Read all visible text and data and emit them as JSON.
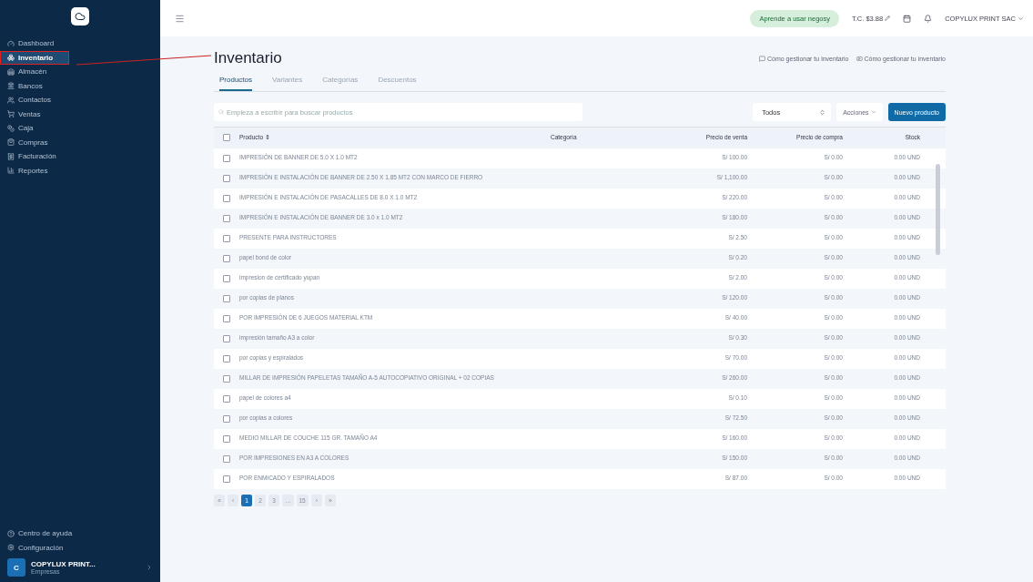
{
  "sidebar": {
    "items": [
      {
        "label": "Dashboard",
        "selected": false,
        "annotated": false
      },
      {
        "label": "Inventario",
        "selected": true,
        "annotated": true
      },
      {
        "label": "Almacén",
        "selected": false,
        "annotated": false
      },
      {
        "label": "Bancos",
        "selected": false,
        "annotated": false
      },
      {
        "label": "Contactos",
        "selected": false,
        "annotated": false
      },
      {
        "label": "Ventas",
        "selected": false,
        "annotated": false
      },
      {
        "label": "Caja",
        "selected": false,
        "annotated": false
      },
      {
        "label": "Compras",
        "selected": false,
        "annotated": false
      },
      {
        "label": "Facturación",
        "selected": false,
        "annotated": false
      },
      {
        "label": "Reportes",
        "selected": false,
        "annotated": false
      }
    ],
    "footer_items": [
      "Centro de ayuda",
      "Configuración"
    ],
    "account": {
      "avatar": "C",
      "name": "COPYLUX PRINT...",
      "subtitle": "Empresas"
    }
  },
  "topbar": {
    "learn_button": "Aprende a usar negosy",
    "exchange_rate": "T.C. $3.88",
    "company": "COPYLUX PRINT SAC"
  },
  "page": {
    "title": "Inventario",
    "help_links": [
      "Cómo gestionar tu inventario",
      "Cómo gestionar tu inventario"
    ],
    "tabs": [
      {
        "label": "Productos",
        "selected": true
      },
      {
        "label": "Variantes",
        "selected": false
      },
      {
        "label": "Categorías",
        "selected": false
      },
      {
        "label": "Descuentos",
        "selected": false
      }
    ],
    "search": {
      "placeholder": "Empieza a escribir para buscar productos"
    },
    "filter": {
      "value": "Todos"
    },
    "actions_button": "Acciones",
    "new_button": "Nuevo producto"
  },
  "table": {
    "header_checked": false,
    "columns": [
      "Producto ⇕",
      "Categoría",
      "Precio de venta",
      "Precio de compra",
      "Stock"
    ],
    "rows": [
      {
        "checked": false,
        "product": "IMPRESIÓN DE BANNER DE 5.0 X 1.0 MT2",
        "price": "S/ 100.00",
        "cost": "S/ 0.00",
        "stock": "0.00 UND"
      },
      {
        "checked": false,
        "product": "IMPRESIÓN E INSTALACIÓN DE BANNER DE 2.50 X 1.85 MT2 CON MARCO DE FIERRO",
        "price": "S/ 1,100.00",
        "cost": "S/ 0.00",
        "stock": "0.00 UND"
      },
      {
        "checked": false,
        "product": "IMPRESIÓN E INSTALACIÓN DE PASACALLES DE 8.0 X 1.0 MT2",
        "price": "S/ 220.00",
        "cost": "S/ 0.00",
        "stock": "0.00 UND"
      },
      {
        "checked": false,
        "product": "IMPRESIÓN E INSTALACIÓN DE BANNER DE 3.0 x 1.0 MT2",
        "price": "S/ 180.00",
        "cost": "S/ 0.00",
        "stock": "0.00 UND"
      },
      {
        "checked": false,
        "product": "PRESENTE PARA INSTRUCTORES",
        "price": "S/ 2.50",
        "cost": "S/ 0.00",
        "stock": "0.00 UND"
      },
      {
        "checked": false,
        "product": "papel bond de color",
        "price": "S/ 0.20",
        "cost": "S/ 0.00",
        "stock": "0.00 UND"
      },
      {
        "checked": false,
        "product": "impresion de certificado yupan",
        "price": "S/ 2.00",
        "cost": "S/ 0.00",
        "stock": "0.00 UND"
      },
      {
        "checked": false,
        "product": "por copias de planos",
        "price": "S/ 120.00",
        "cost": "S/ 0.00",
        "stock": "0.00 UND"
      },
      {
        "checked": false,
        "product": "POR IMPRESIÓN DE 6 JUEGOS MATERIAL KTM",
        "price": "S/ 40.00",
        "cost": "S/ 0.00",
        "stock": "0.00 UND"
      },
      {
        "checked": false,
        "product": "impresión tamaño A3 a color",
        "price": "S/ 0.30",
        "cost": "S/ 0.00",
        "stock": "0.00 UND"
      },
      {
        "checked": false,
        "product": "por copias y espiralados",
        "price": "S/ 70.00",
        "cost": "S/ 0.00",
        "stock": "0.00 UND"
      },
      {
        "checked": false,
        "product": "MILLAR DE IMPRESIÓN PAPELETAS TAMAÑO A-5 AUTOCOPIATIVO ORIGINAL + 02 COPIAS",
        "price": "S/ 260.00",
        "cost": "S/ 0.00",
        "stock": "0.00 UND"
      },
      {
        "checked": false,
        "product": "papel de colores a4",
        "price": "S/ 0.10",
        "cost": "S/ 0.00",
        "stock": "0.00 UND"
      },
      {
        "checked": false,
        "product": "por copias a colores",
        "price": "S/ 72.50",
        "cost": "S/ 0.00",
        "stock": "0.00 UND"
      },
      {
        "checked": false,
        "product": "MEDIO MILLAR DE COUCHE 115 GR. TAMAÑO A4",
        "price": "S/ 160.00",
        "cost": "S/ 0.00",
        "stock": "0.00 UND"
      },
      {
        "checked": false,
        "product": "POR IMPRESIONES EN A3 A COLORES",
        "price": "S/ 150.00",
        "cost": "S/ 0.00",
        "stock": "0.00 UND"
      },
      {
        "checked": false,
        "product": "POR ENMICADO Y ESPIRALADOS",
        "price": "S/ 87.00",
        "cost": "S/ 0.00",
        "stock": "0.00 UND"
      }
    ]
  },
  "pagination": [
    {
      "label": "«",
      "selected": false
    },
    {
      "label": "‹",
      "selected": false
    },
    {
      "label": "1",
      "selected": true
    },
    {
      "label": "2",
      "selected": false
    },
    {
      "label": "3",
      "selected": false
    },
    {
      "label": "…",
      "selected": false
    },
    {
      "label": "15",
      "selected": false
    },
    {
      "label": "›",
      "selected": false
    },
    {
      "label": "»",
      "selected": false
    }
  ]
}
